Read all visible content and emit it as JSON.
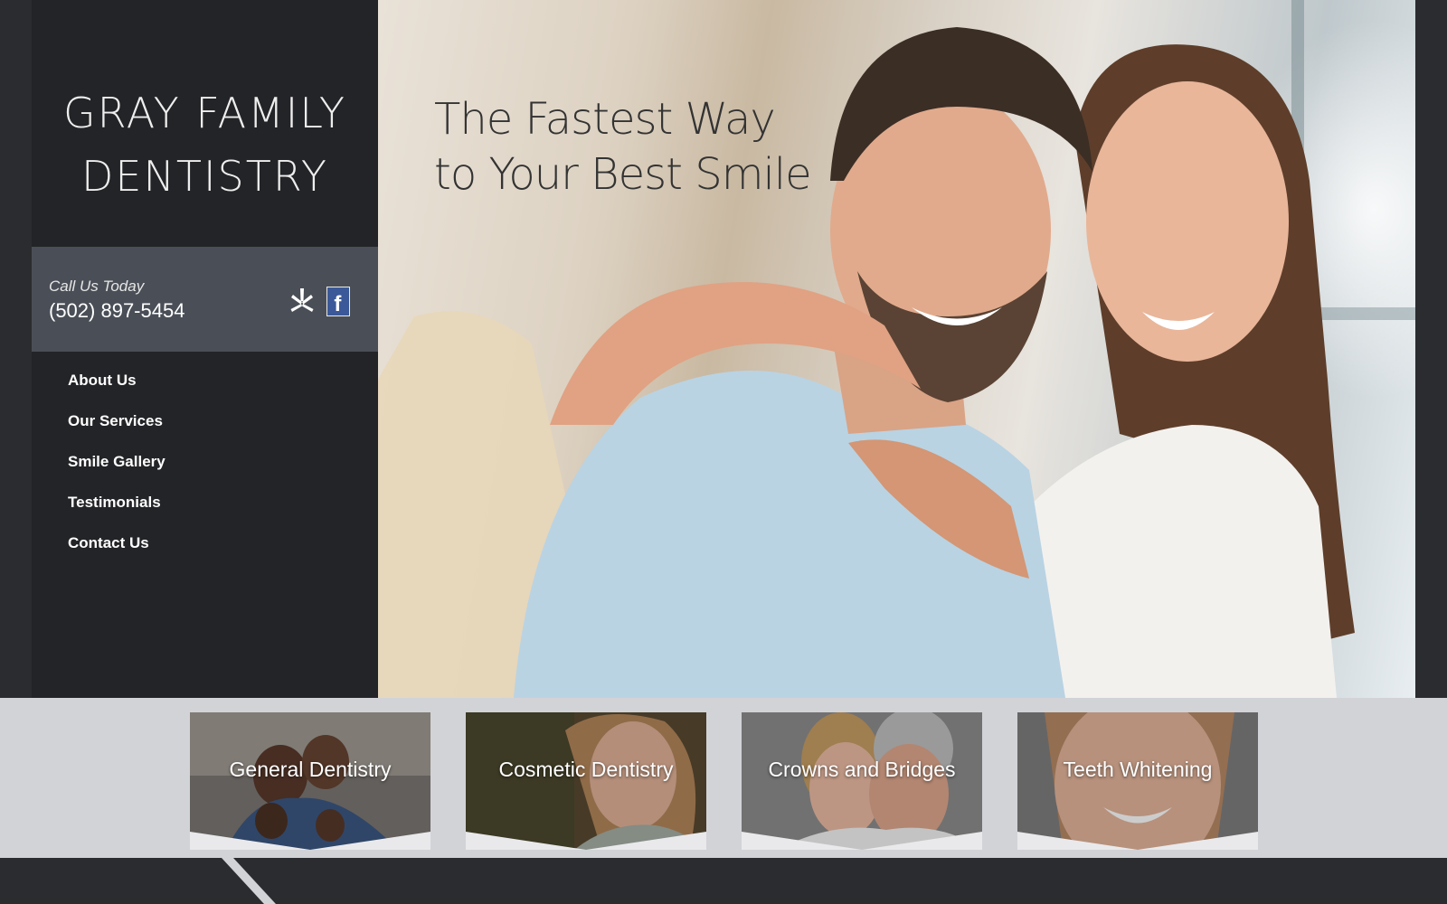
{
  "brand": {
    "name_line1": "GRAY FAMILY",
    "name_line2": "DENTISTRY"
  },
  "contact": {
    "call_label": "Call Us Today",
    "phone": "(502) 897-5454"
  },
  "social": {
    "icons": [
      "yelp-icon",
      "facebook-icon"
    ],
    "facebook_letter": "f"
  },
  "nav": {
    "items": [
      {
        "label": "About Us"
      },
      {
        "label": "Our Services"
      },
      {
        "label": "Smile Gallery"
      },
      {
        "label": "Testimonials"
      },
      {
        "label": "Contact Us"
      }
    ]
  },
  "hero": {
    "headline_line1": "The Fastest Way",
    "headline_line2": "to Your Best Smile"
  },
  "services": [
    {
      "label": "General Dentistry"
    },
    {
      "label": "Cosmetic Dentistry"
    },
    {
      "label": "Crowns and Bridges"
    },
    {
      "label": "Teeth Whitening"
    }
  ],
  "colors": {
    "page_background": "#2b2c2f",
    "sidebar": "#232427",
    "call_box": "#4a4f57",
    "services_band": "#d2d3d7",
    "facebook_blue": "#3b5998"
  }
}
